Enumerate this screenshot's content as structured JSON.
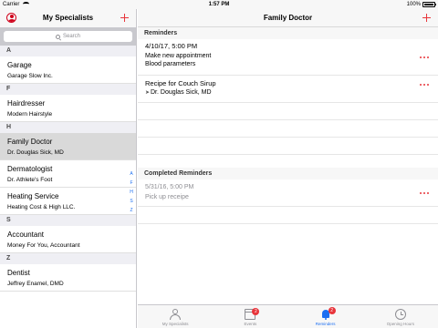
{
  "status_bar": {
    "carrier": "Carrier",
    "time": "1:57 PM",
    "battery": "100%",
    "battery_level": 1.0
  },
  "sidebar": {
    "title": "My Specialists",
    "search_placeholder": "Search",
    "sections": [
      {
        "letter": "A",
        "rows": [
          {
            "title": "Garage",
            "subtitle": "Garage Slow Inc."
          }
        ]
      },
      {
        "letter": "F",
        "rows": [
          {
            "title": "Hairdresser",
            "subtitle": "Modern Hairstyle"
          }
        ]
      },
      {
        "letter": "H",
        "rows": [
          {
            "title": "Family Doctor",
            "subtitle": "Dr. Douglas Sick, MD",
            "selected": true
          },
          {
            "title": "Dermatologist",
            "subtitle": "Dr. Athlete's Foot"
          },
          {
            "title": "Heating Service",
            "subtitle": "Heating Cost & High LLC."
          }
        ]
      },
      {
        "letter": "S",
        "rows": [
          {
            "title": "Accountant",
            "subtitle": "Money For You, Accountant"
          }
        ]
      },
      {
        "letter": "Z",
        "rows": [
          {
            "title": "Dentist",
            "subtitle": "Jeffrey Enamel, DMD"
          }
        ]
      }
    ],
    "index_letters": [
      "A",
      "F",
      "H",
      "S",
      "Z"
    ]
  },
  "main": {
    "title": "Family Doctor",
    "reminders_header": "Reminders",
    "reminders": [
      {
        "date": "4/10/17, 5:00 PM",
        "line1": "Make new appointment",
        "line2": "Blood parameters"
      },
      {
        "title": "Recipe for Couch Sirup",
        "line2": "Dr. Douglas Sick, MD"
      }
    ],
    "completed_header": "Completed Reminders",
    "completed": [
      {
        "date": "5/31/16, 5:00 PM",
        "line1": "Pick up receipe"
      }
    ]
  },
  "tabbar": {
    "tabs": [
      {
        "label": "My Specialists",
        "icon": "person-icon"
      },
      {
        "label": "Events",
        "icon": "calendar-icon",
        "badge": "2"
      },
      {
        "label": "Reminders",
        "icon": "bell-icon",
        "badge": "2",
        "active": true
      },
      {
        "label": "Opening Hours",
        "icon": "clock-icon"
      }
    ]
  },
  "colors": {
    "accent": "#e8353b",
    "active_tab": "#1b6ef2",
    "selected_row": "#d9d9d9"
  }
}
